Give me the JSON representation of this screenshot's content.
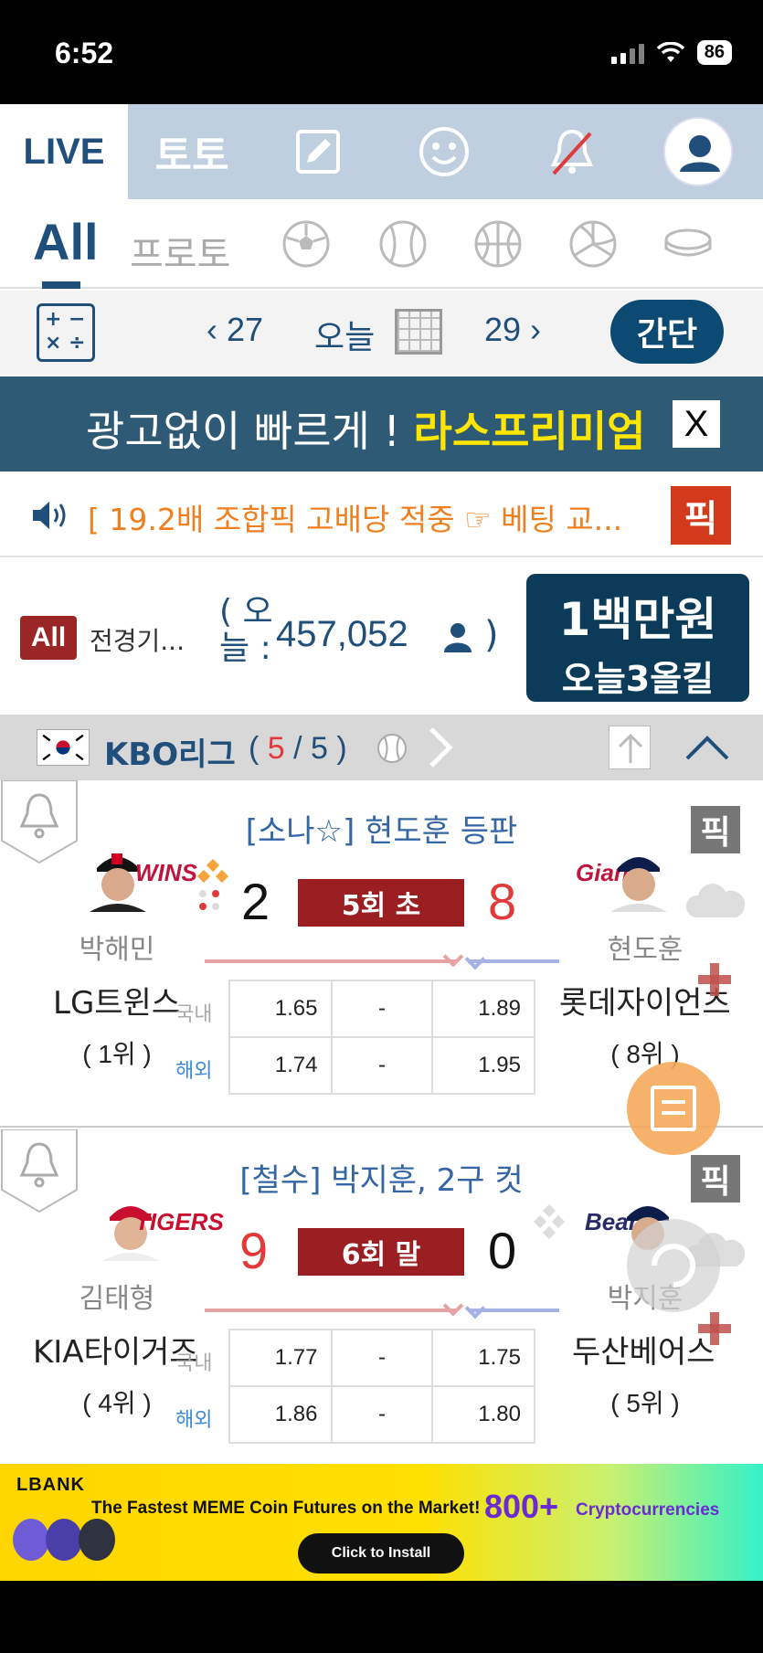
{
  "status_bar": {
    "time": "6:52",
    "battery": "86"
  },
  "top_nav": {
    "live_label": "LIVE",
    "toto_label": "토토"
  },
  "sport_tabs": {
    "all_label": "All",
    "proto_label": "프로토"
  },
  "date_bar": {
    "prev_label": "27",
    "today_label": "오늘",
    "next_label": "29",
    "simple_button": "간단"
  },
  "ad_banner": {
    "text": "광고없이 빠르게 ! ",
    "highlight": "라스프리미엄",
    "close_label": "X"
  },
  "notice": {
    "text": "[ 19.2배 조합픽 고배당 적중 ☞ 베팅 교...",
    "pick_label": "픽"
  },
  "stats": {
    "all_badge": "All",
    "label": "전경기...",
    "paren_open": "( 오늘 :",
    "count": "457,052",
    "paren_close": ")",
    "promo_line1": "1백만원",
    "promo_line2": "오늘3올킬"
  },
  "league": {
    "name": "KBO리그",
    "count_open": "( ",
    "live_count": "5",
    "count_rest": " / 5 )"
  },
  "matches": [
    {
      "headline": "[소나☆] 현도훈 등판",
      "pick_label": "픽",
      "home_pitcher": "박해민",
      "away_pitcher": "현도훈",
      "home_logo": "WINS",
      "away_logo": "Giants",
      "home_score": "2",
      "away_score": "8",
      "inning": "5회 초",
      "home_team": "LG트윈스",
      "away_team": "롯데자이언츠",
      "home_rank": "( 1위 )",
      "away_rank": "( 8위 )",
      "odds": [
        {
          "label": "국내",
          "home": "1.65",
          "draw": "-",
          "away": "1.89"
        },
        {
          "label": "해외",
          "home": "1.74",
          "draw": "-",
          "away": "1.95"
        }
      ]
    },
    {
      "headline": "[철수] 박지훈, 2구 컷",
      "pick_label": "픽",
      "home_pitcher": "김태형",
      "away_pitcher": "박지훈",
      "home_logo": "TIGERS",
      "away_logo": "Bears",
      "home_score": "9",
      "away_score": "0",
      "inning": "6회 말",
      "home_team": "KIA타이거즈",
      "away_team": "두산베어스",
      "home_rank": "( 4위 )",
      "away_rank": "( 5위 )",
      "odds": [
        {
          "label": "국내",
          "home": "1.77",
          "draw": "-",
          "away": "1.75"
        },
        {
          "label": "해외",
          "home": "1.86",
          "draw": "-",
          "away": "1.80"
        }
      ]
    }
  ],
  "lbank_ad": {
    "logo": "LBANK",
    "text": "The Fastest MEME Coin Futures on the Market!",
    "number": "800+",
    "crypto": "Cryptocurrencies",
    "install": "Click to Install"
  },
  "colors": {
    "primary": "#1f4f7a",
    "accent_red": "#9b1f22",
    "notice_orange": "#f07f1f",
    "highlight_yellow": "#ffe600"
  }
}
